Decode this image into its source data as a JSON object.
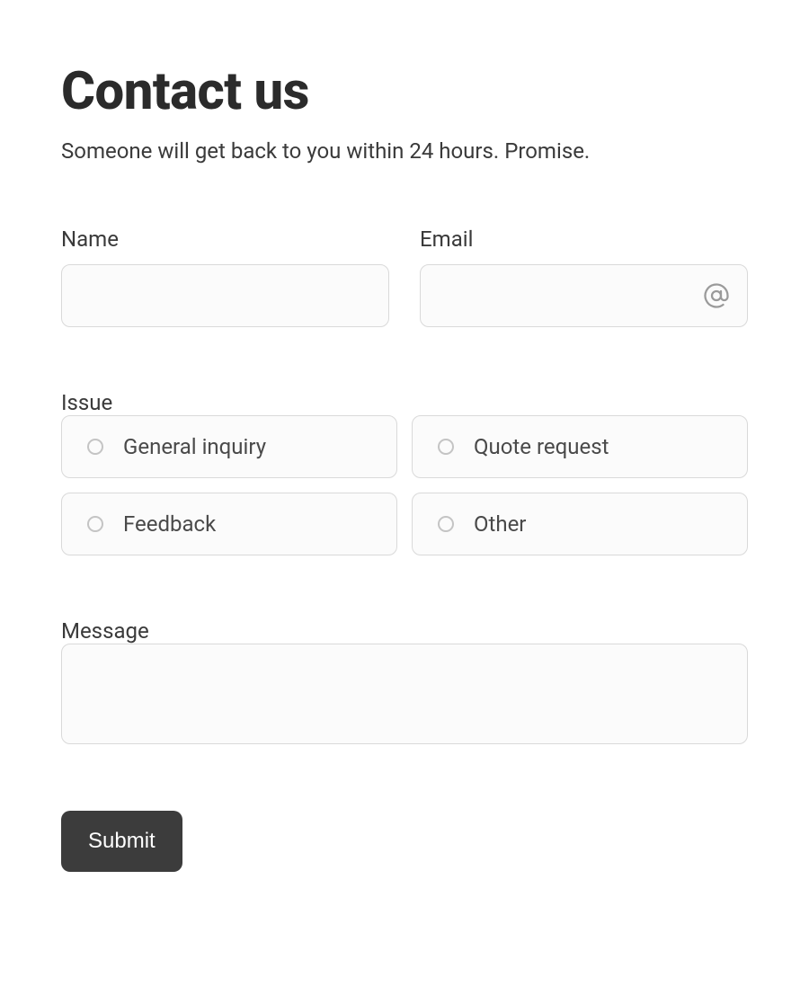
{
  "header": {
    "title": "Contact us",
    "subtitle": "Someone will get back to you within 24 hours. Promise."
  },
  "form": {
    "name": {
      "label": "Name",
      "value": ""
    },
    "email": {
      "label": "Email",
      "value": ""
    },
    "issue": {
      "label": "Issue",
      "options": [
        "General inquiry",
        "Quote request",
        "Feedback",
        "Other"
      ]
    },
    "message": {
      "label": "Message",
      "value": ""
    },
    "submit_label": "Submit"
  }
}
